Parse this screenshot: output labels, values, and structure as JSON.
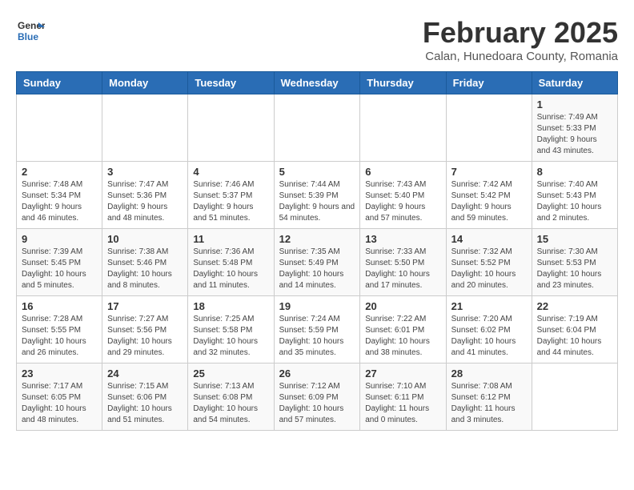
{
  "header": {
    "logo": {
      "text_general": "General",
      "text_blue": "Blue"
    },
    "month_year": "February 2025",
    "location": "Calan, Hunedoara County, Romania"
  },
  "weekdays": [
    "Sunday",
    "Monday",
    "Tuesday",
    "Wednesday",
    "Thursday",
    "Friday",
    "Saturday"
  ],
  "weeks": [
    [
      {
        "day": "",
        "info": ""
      },
      {
        "day": "",
        "info": ""
      },
      {
        "day": "",
        "info": ""
      },
      {
        "day": "",
        "info": ""
      },
      {
        "day": "",
        "info": ""
      },
      {
        "day": "",
        "info": ""
      },
      {
        "day": "1",
        "info": "Sunrise: 7:49 AM\nSunset: 5:33 PM\nDaylight: 9 hours and 43 minutes."
      }
    ],
    [
      {
        "day": "2",
        "info": "Sunrise: 7:48 AM\nSunset: 5:34 PM\nDaylight: 9 hours and 46 minutes."
      },
      {
        "day": "3",
        "info": "Sunrise: 7:47 AM\nSunset: 5:36 PM\nDaylight: 9 hours and 48 minutes."
      },
      {
        "day": "4",
        "info": "Sunrise: 7:46 AM\nSunset: 5:37 PM\nDaylight: 9 hours and 51 minutes."
      },
      {
        "day": "5",
        "info": "Sunrise: 7:44 AM\nSunset: 5:39 PM\nDaylight: 9 hours and 54 minutes."
      },
      {
        "day": "6",
        "info": "Sunrise: 7:43 AM\nSunset: 5:40 PM\nDaylight: 9 hours and 57 minutes."
      },
      {
        "day": "7",
        "info": "Sunrise: 7:42 AM\nSunset: 5:42 PM\nDaylight: 9 hours and 59 minutes."
      },
      {
        "day": "8",
        "info": "Sunrise: 7:40 AM\nSunset: 5:43 PM\nDaylight: 10 hours and 2 minutes."
      }
    ],
    [
      {
        "day": "9",
        "info": "Sunrise: 7:39 AM\nSunset: 5:45 PM\nDaylight: 10 hours and 5 minutes."
      },
      {
        "day": "10",
        "info": "Sunrise: 7:38 AM\nSunset: 5:46 PM\nDaylight: 10 hours and 8 minutes."
      },
      {
        "day": "11",
        "info": "Sunrise: 7:36 AM\nSunset: 5:48 PM\nDaylight: 10 hours and 11 minutes."
      },
      {
        "day": "12",
        "info": "Sunrise: 7:35 AM\nSunset: 5:49 PM\nDaylight: 10 hours and 14 minutes."
      },
      {
        "day": "13",
        "info": "Sunrise: 7:33 AM\nSunset: 5:50 PM\nDaylight: 10 hours and 17 minutes."
      },
      {
        "day": "14",
        "info": "Sunrise: 7:32 AM\nSunset: 5:52 PM\nDaylight: 10 hours and 20 minutes."
      },
      {
        "day": "15",
        "info": "Sunrise: 7:30 AM\nSunset: 5:53 PM\nDaylight: 10 hours and 23 minutes."
      }
    ],
    [
      {
        "day": "16",
        "info": "Sunrise: 7:28 AM\nSunset: 5:55 PM\nDaylight: 10 hours and 26 minutes."
      },
      {
        "day": "17",
        "info": "Sunrise: 7:27 AM\nSunset: 5:56 PM\nDaylight: 10 hours and 29 minutes."
      },
      {
        "day": "18",
        "info": "Sunrise: 7:25 AM\nSunset: 5:58 PM\nDaylight: 10 hours and 32 minutes."
      },
      {
        "day": "19",
        "info": "Sunrise: 7:24 AM\nSunset: 5:59 PM\nDaylight: 10 hours and 35 minutes."
      },
      {
        "day": "20",
        "info": "Sunrise: 7:22 AM\nSunset: 6:01 PM\nDaylight: 10 hours and 38 minutes."
      },
      {
        "day": "21",
        "info": "Sunrise: 7:20 AM\nSunset: 6:02 PM\nDaylight: 10 hours and 41 minutes."
      },
      {
        "day": "22",
        "info": "Sunrise: 7:19 AM\nSunset: 6:04 PM\nDaylight: 10 hours and 44 minutes."
      }
    ],
    [
      {
        "day": "23",
        "info": "Sunrise: 7:17 AM\nSunset: 6:05 PM\nDaylight: 10 hours and 48 minutes."
      },
      {
        "day": "24",
        "info": "Sunrise: 7:15 AM\nSunset: 6:06 PM\nDaylight: 10 hours and 51 minutes."
      },
      {
        "day": "25",
        "info": "Sunrise: 7:13 AM\nSunset: 6:08 PM\nDaylight: 10 hours and 54 minutes."
      },
      {
        "day": "26",
        "info": "Sunrise: 7:12 AM\nSunset: 6:09 PM\nDaylight: 10 hours and 57 minutes."
      },
      {
        "day": "27",
        "info": "Sunrise: 7:10 AM\nSunset: 6:11 PM\nDaylight: 11 hours and 0 minutes."
      },
      {
        "day": "28",
        "info": "Sunrise: 7:08 AM\nSunset: 6:12 PM\nDaylight: 11 hours and 3 minutes."
      },
      {
        "day": "",
        "info": ""
      }
    ]
  ]
}
